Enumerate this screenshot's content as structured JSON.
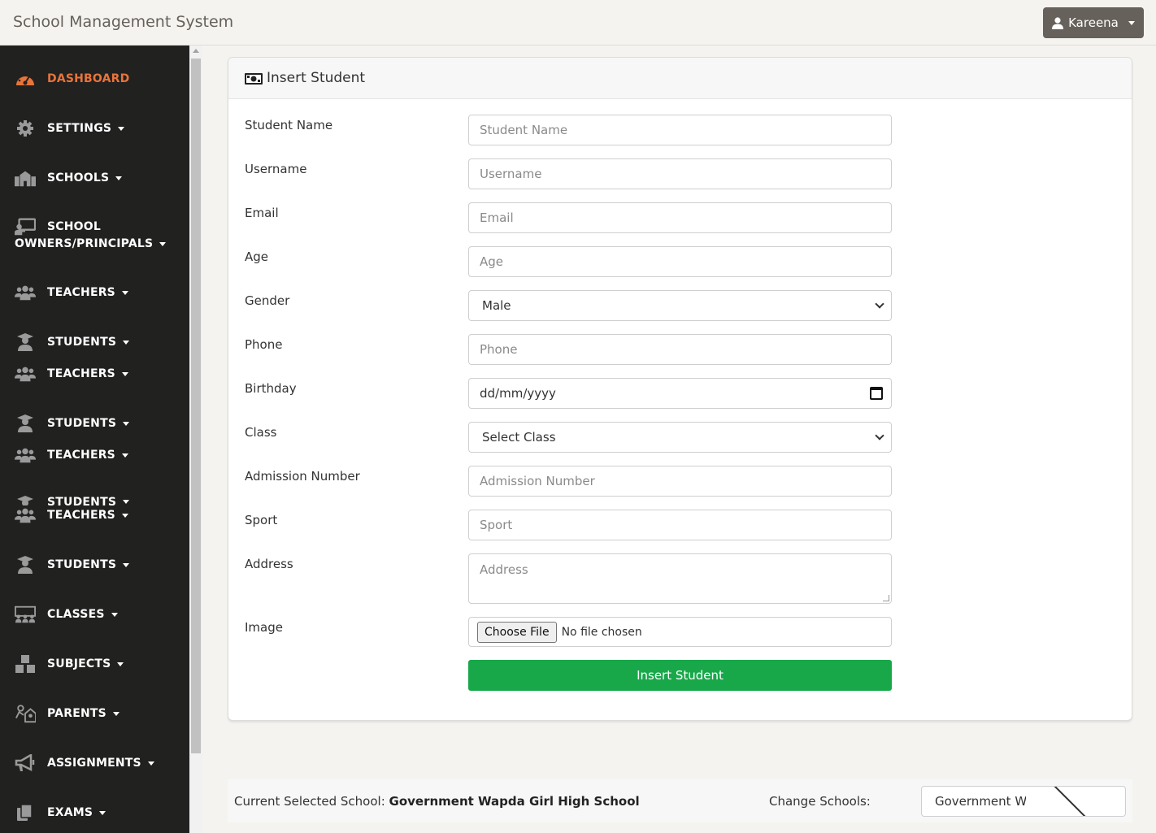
{
  "app": {
    "brand": "School Management System"
  },
  "user": {
    "name": "Kareena",
    "icon": "user-icon"
  },
  "sidebar": {
    "items": [
      {
        "label": "DASHBOARD",
        "icon": "dashboard-gauge-icon",
        "active": true
      },
      {
        "label": "SETTINGS",
        "icon": "gear-icon"
      },
      {
        "label": "SCHOOLS",
        "icon": "school-building-icon"
      },
      {
        "label_line1": "SCHOOL",
        "label_line2": "OWNERS/PRINCIPALS",
        "icon": "chalkboard-teacher-icon"
      },
      {
        "label": "TEACHERS",
        "icon": "users-icon"
      },
      {
        "label": "STUDENTS",
        "icon": "graduate-icon"
      },
      {
        "label": "TEACHERS",
        "icon": "users-icon"
      },
      {
        "label": "STUDENTS",
        "icon": "graduate-icon"
      },
      {
        "label": "TEACHERS",
        "icon": "users-icon"
      },
      {
        "label": "STUDENTS",
        "icon": "graduate-icon"
      },
      {
        "label": "TEACHERS",
        "icon": "users-icon"
      },
      {
        "label": "STUDENTS",
        "icon": "graduate-icon"
      },
      {
        "label": "CLASSES",
        "icon": "classroom-icon"
      },
      {
        "label": "SUBJECTS",
        "icon": "cubes-icon"
      },
      {
        "label": "PARENTS",
        "icon": "parent-child-icon"
      },
      {
        "label": "ASSIGNMENTS",
        "icon": "megaphone-icon"
      },
      {
        "label": "EXAMS",
        "icon": "copy-icon"
      }
    ]
  },
  "card": {
    "title": "Insert Student",
    "title_icon": "money-bill-icon",
    "fields": {
      "student_name": {
        "label": "Student Name",
        "placeholder": "Student Name"
      },
      "username": {
        "label": "Username",
        "placeholder": "Username"
      },
      "email": {
        "label": "Email",
        "placeholder": "Email"
      },
      "age": {
        "label": "Age",
        "placeholder": "Age"
      },
      "gender": {
        "label": "Gender",
        "value": "Male"
      },
      "phone": {
        "label": "Phone",
        "placeholder": "Phone"
      },
      "birthday": {
        "label": "Birthday",
        "value": "dd/mm/yyyy"
      },
      "class": {
        "label": "Class",
        "value": "Select Class"
      },
      "admission_number": {
        "label": "Admission Number",
        "placeholder": "Admission Number"
      },
      "sport": {
        "label": "Sport",
        "placeholder": "Sport"
      },
      "address": {
        "label": "Address",
        "placeholder": "Address"
      },
      "image": {
        "label": "Image",
        "button": "Choose File",
        "status": "No file chosen"
      }
    },
    "submit_label": "Insert Student",
    "submit_color": "#18a84a"
  },
  "footer": {
    "current_label": "Current Selected School:",
    "current_school": "Government Wapda Girl High School",
    "change_label": "Change Schools:",
    "school_select_value": "Government Wapda Girl High School"
  },
  "colors": {
    "sidebar_bg": "#212120",
    "active": "#e8743b",
    "page_bg": "#f4f3ef"
  }
}
